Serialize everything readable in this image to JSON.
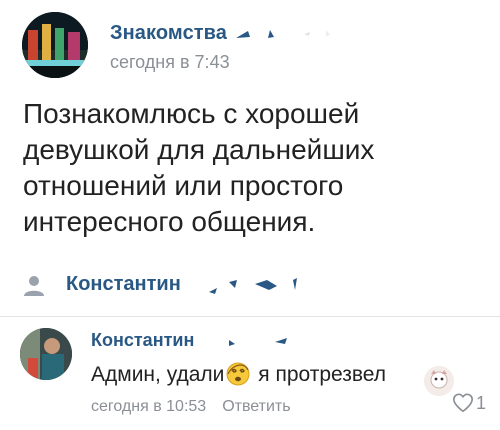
{
  "post": {
    "group_name": "Знакомства",
    "time": "сегодня в 7:43",
    "text_lines": [
      "Познакомлюсь с хорошей",
      "девушкой для дальнейших",
      "отношений или простого",
      "интересного общения."
    ],
    "signer": "Константин"
  },
  "comment": {
    "author": "Константин",
    "text_before": "Админ, удали",
    "text_after": "я протрезвел",
    "time": "сегодня в 10:53",
    "reply_label": "Ответить",
    "likes": "1"
  },
  "icons": {
    "signer": "person-icon",
    "emoji": "dizzy-face-emoji",
    "like": "heart-icon"
  },
  "colors": {
    "link": "#2a5885",
    "meta": "#8a8f96",
    "text": "#222222"
  }
}
